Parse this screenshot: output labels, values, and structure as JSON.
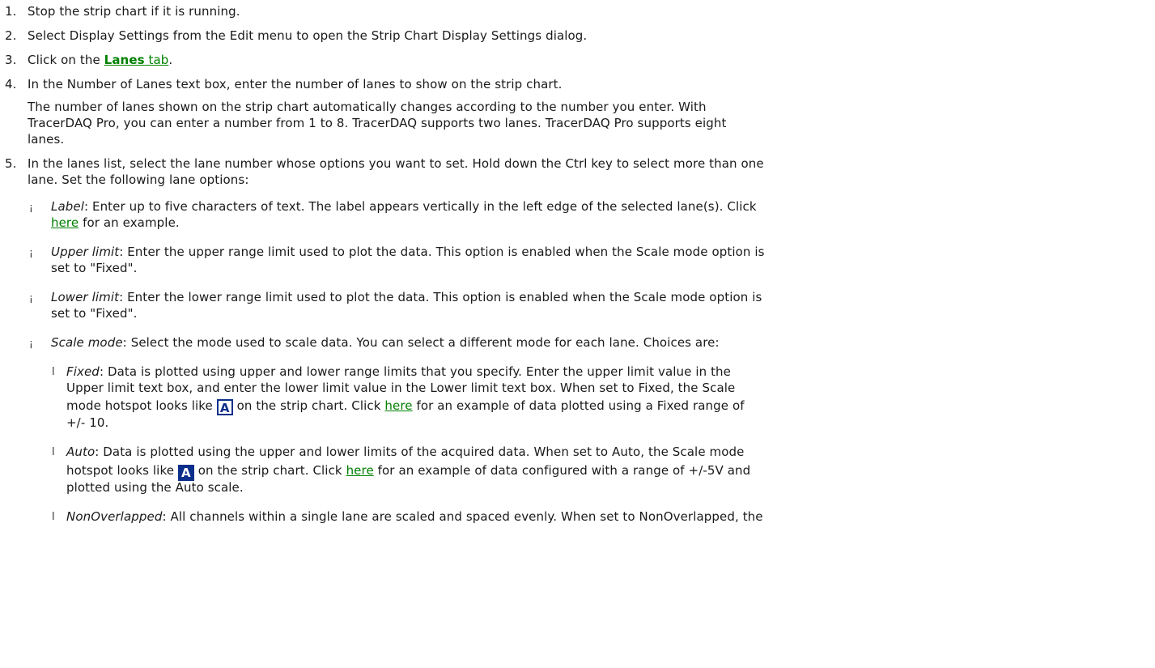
{
  "steps": {
    "s1_num": "1.",
    "s1": "Stop the strip chart if it is running.",
    "s2_num": "2.",
    "s2": "Select Display Settings from the Edit menu to open the Strip Chart Display Settings dialog.",
    "s3_num": "3.",
    "s3_pre": "Click on the ",
    "s3_link_bold": "Lanes",
    "s3_link_rest": " tab",
    "s3_post": ".",
    "s4_num": "4.",
    "s4": "In the Number of Lanes text box, enter the number of lanes to show on the strip chart.",
    "s4_note_l1": "The number of lanes shown on the strip chart automatically changes according to the number you enter. With",
    "s4_note_l2": "TracerDAQ Pro, you can enter a number from 1 to 8. TracerDAQ supports two lanes. TracerDAQ Pro supports eight",
    "s4_note_l3": "lanes.",
    "s5_num": "5.",
    "s5_l1": "In the lanes list, select the lane number whose options you want to set. Hold down the Ctrl key to select more than one",
    "s5_l2": "lane. Set the following lane options:"
  },
  "options": {
    "bullet": "¡",
    "label_term": "Label",
    "label_l1": ": Enter up to five characters of text. The label appears vertically in the left edge of the selected lane(s). Click",
    "label_link": "here",
    "label_l2": " for an example.",
    "upper_term": "Upper limit",
    "upper_l1": ": Enter the upper range limit used to plot the data. This option is enabled when the Scale mode option is",
    "upper_l2": "set to \"Fixed\".",
    "lower_term": "Lower limit",
    "lower_l1": ": Enter the lower range limit used to plot the data. This option is enabled when the Scale mode option is",
    "lower_l2": "set to \"Fixed\".",
    "scale_term": "Scale mode",
    "scale_l1": ": Select the mode used to scale data. You can select a different mode for each lane. Choices are:"
  },
  "modes": {
    "marker": "l",
    "fixed_term": "Fixed",
    "fixed_l1": ": Data is plotted using upper and lower range limits that you specify. Enter the upper limit value in the",
    "fixed_l2": "Upper limit text box, and enter the lower limit value in the Lower limit text box. When set to Fixed, the Scale",
    "fixed_l3_pre": "mode hotspot looks like ",
    "fixed_l3_mid": " on the strip chart. Click ",
    "fixed_link": "here",
    "fixed_l3_post": " for an example of data plotted using a Fixed range of",
    "fixed_l4": "+/- 10.",
    "auto_term": "Auto",
    "auto_l1": ": Data is plotted using the upper and lower limits of the acquired data. When set to Auto, the Scale mode",
    "auto_l2_pre": "hotspot looks like ",
    "auto_l2_mid": " on the strip chart. Click ",
    "auto_link": "here",
    "auto_l2_post": " for an example of data configured with a range of +/-5V and",
    "auto_l3": "plotted using the Auto scale.",
    "nonoverlapped_term": "NonOverlapped",
    "nonoverlapped_l1": ": All channels within a single lane are scaled and spaced evenly. When set to NonOverlapped, the"
  },
  "icons": {
    "glyph": "A",
    "fixed_icon": "scale-fixed-hotspot-icon",
    "auto_icon": "scale-auto-hotspot-icon",
    "icon_color": "#0b2f8a",
    "link_color": "#008000"
  }
}
